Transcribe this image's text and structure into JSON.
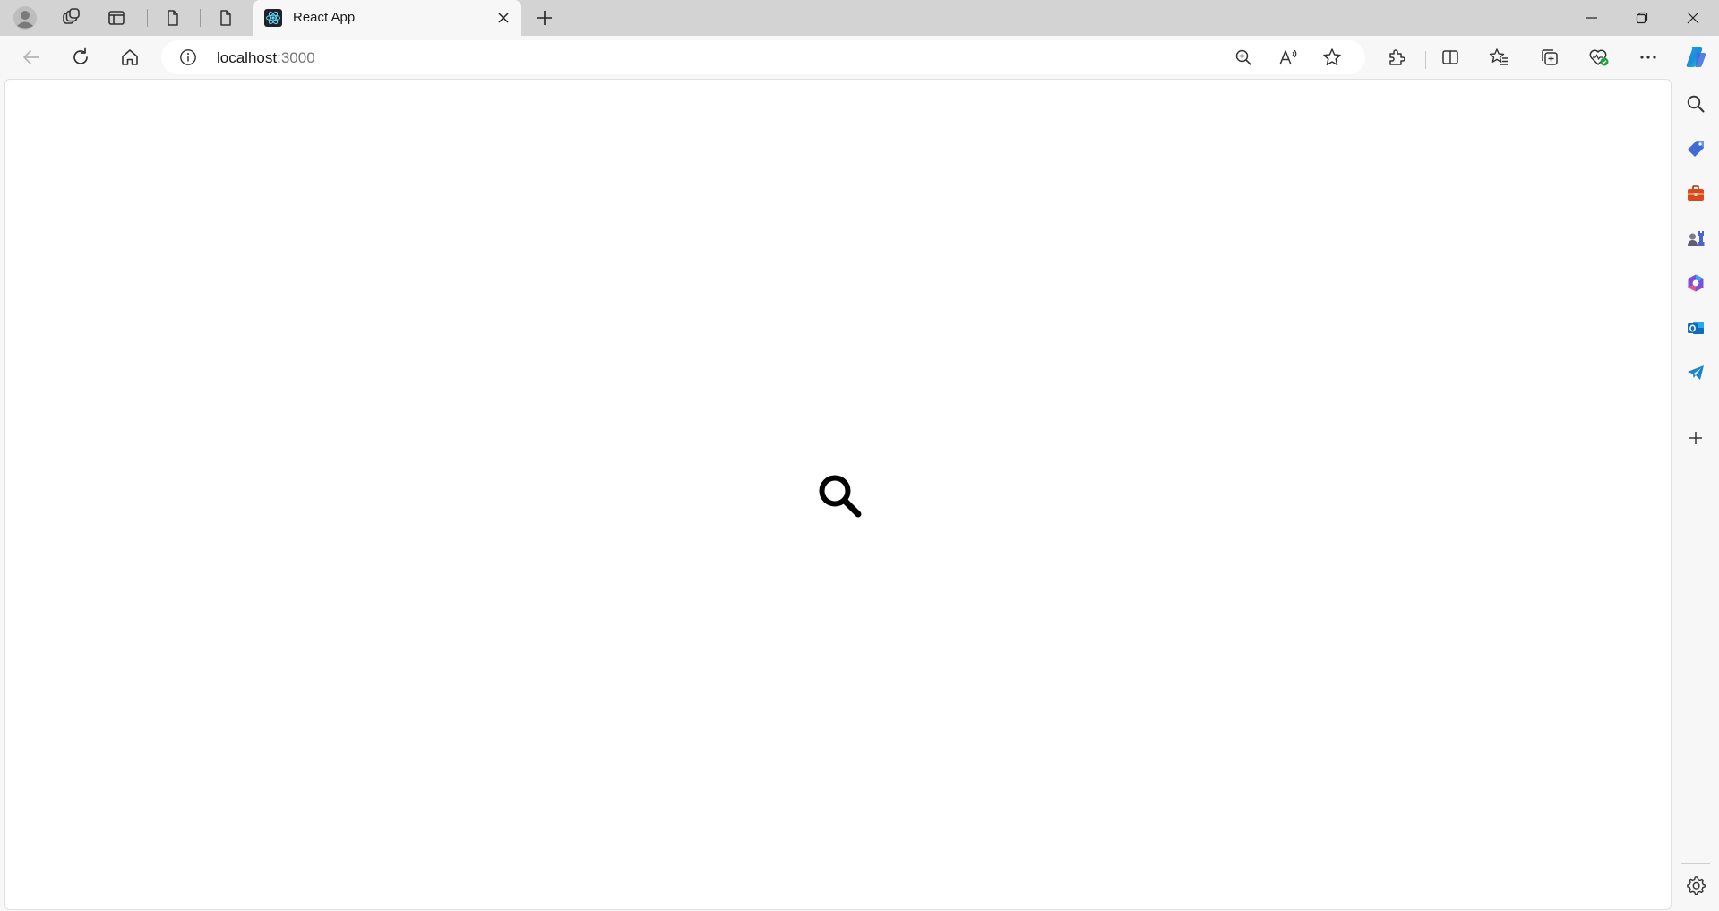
{
  "tab": {
    "title": "React App",
    "favicon": "react-icon"
  },
  "address": {
    "host": "localhost",
    "port": ":3000"
  },
  "page": {
    "center_icon": "search-icon"
  },
  "sidebar": {
    "items": [
      "search-icon",
      "shopping-tag-icon",
      "tools-icon",
      "games-icon",
      "microsoft-365-icon",
      "outlook-icon",
      "telegram-icon",
      "add-icon",
      "settings-icon"
    ]
  },
  "colors": {
    "tabstrip": "#d3d3d3",
    "toolbar": "#f7f7f7",
    "page": "#ffffff",
    "copilot": "#1b8bd8",
    "shopping": "#3f6ad8",
    "tools": "#d64a1c",
    "outlook": "#0f6cbd",
    "telegram": "#1b84c9",
    "health_badge": "#20a040"
  }
}
